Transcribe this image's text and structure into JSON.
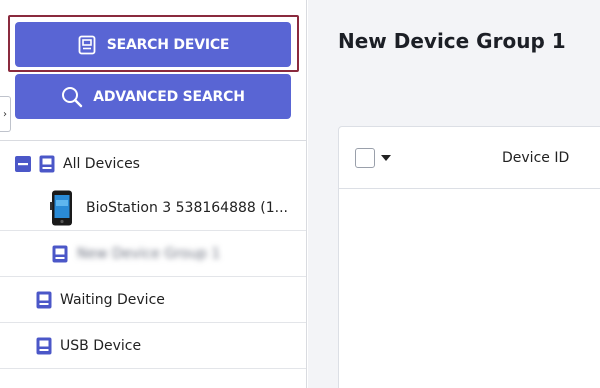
{
  "sidebar": {
    "search_device_label": "SEARCH DEVICE",
    "advanced_search_label": "ADVANCED SEARCH",
    "collapse_glyph": "›",
    "tree": {
      "all_devices": "All Devices",
      "biostation": "BioStation 3 538164888 (1...",
      "device_group": "New Device Group 1",
      "waiting_device": "Waiting Device",
      "usb_device": "USB Device"
    }
  },
  "main": {
    "title": "New Device Group 1",
    "table": {
      "columns": [
        "Device ID"
      ]
    }
  },
  "colors": {
    "accent": "#5965d4",
    "highlight": "#8a2a3e",
    "tree_icon": "#4b57c8"
  },
  "icons": {
    "search_device": "device-icon",
    "advanced_search": "magnifier-icon",
    "collapse": "chevron-right-icon",
    "tree_toggle": "minus-square-icon",
    "tree_node": "device-group-icon",
    "biostation": "biostation-device-icon"
  }
}
